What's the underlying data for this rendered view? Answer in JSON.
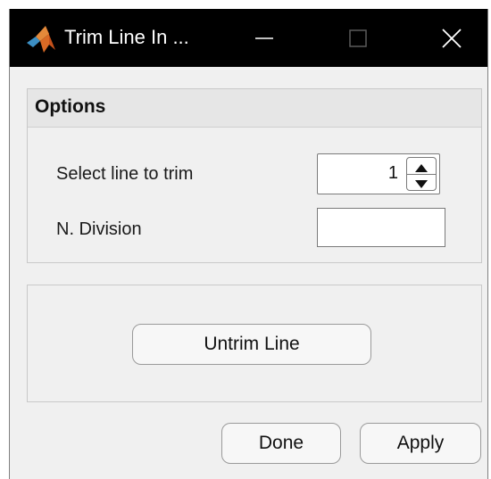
{
  "window": {
    "title": "Trim Line In ...",
    "controls": {
      "minimize": "minimize-icon",
      "maximize": "maximize-icon",
      "close": "close-icon"
    }
  },
  "options": {
    "header": "Options",
    "select_line_label": "Select line to trim",
    "select_line_value": "1",
    "n_division_label": "N. Division",
    "n_division_value": ""
  },
  "actions": {
    "untrim_label": "Untrim Line",
    "done_label": "Done",
    "apply_label": "Apply"
  },
  "icons": {
    "app": "matlab-logo-icon",
    "spin_up": "arrow-up-icon",
    "spin_down": "arrow-down-icon"
  },
  "colors": {
    "titlebar": "#000000",
    "dialog_background": "#f0f0f0",
    "panel_header": "#e6e6e6"
  }
}
